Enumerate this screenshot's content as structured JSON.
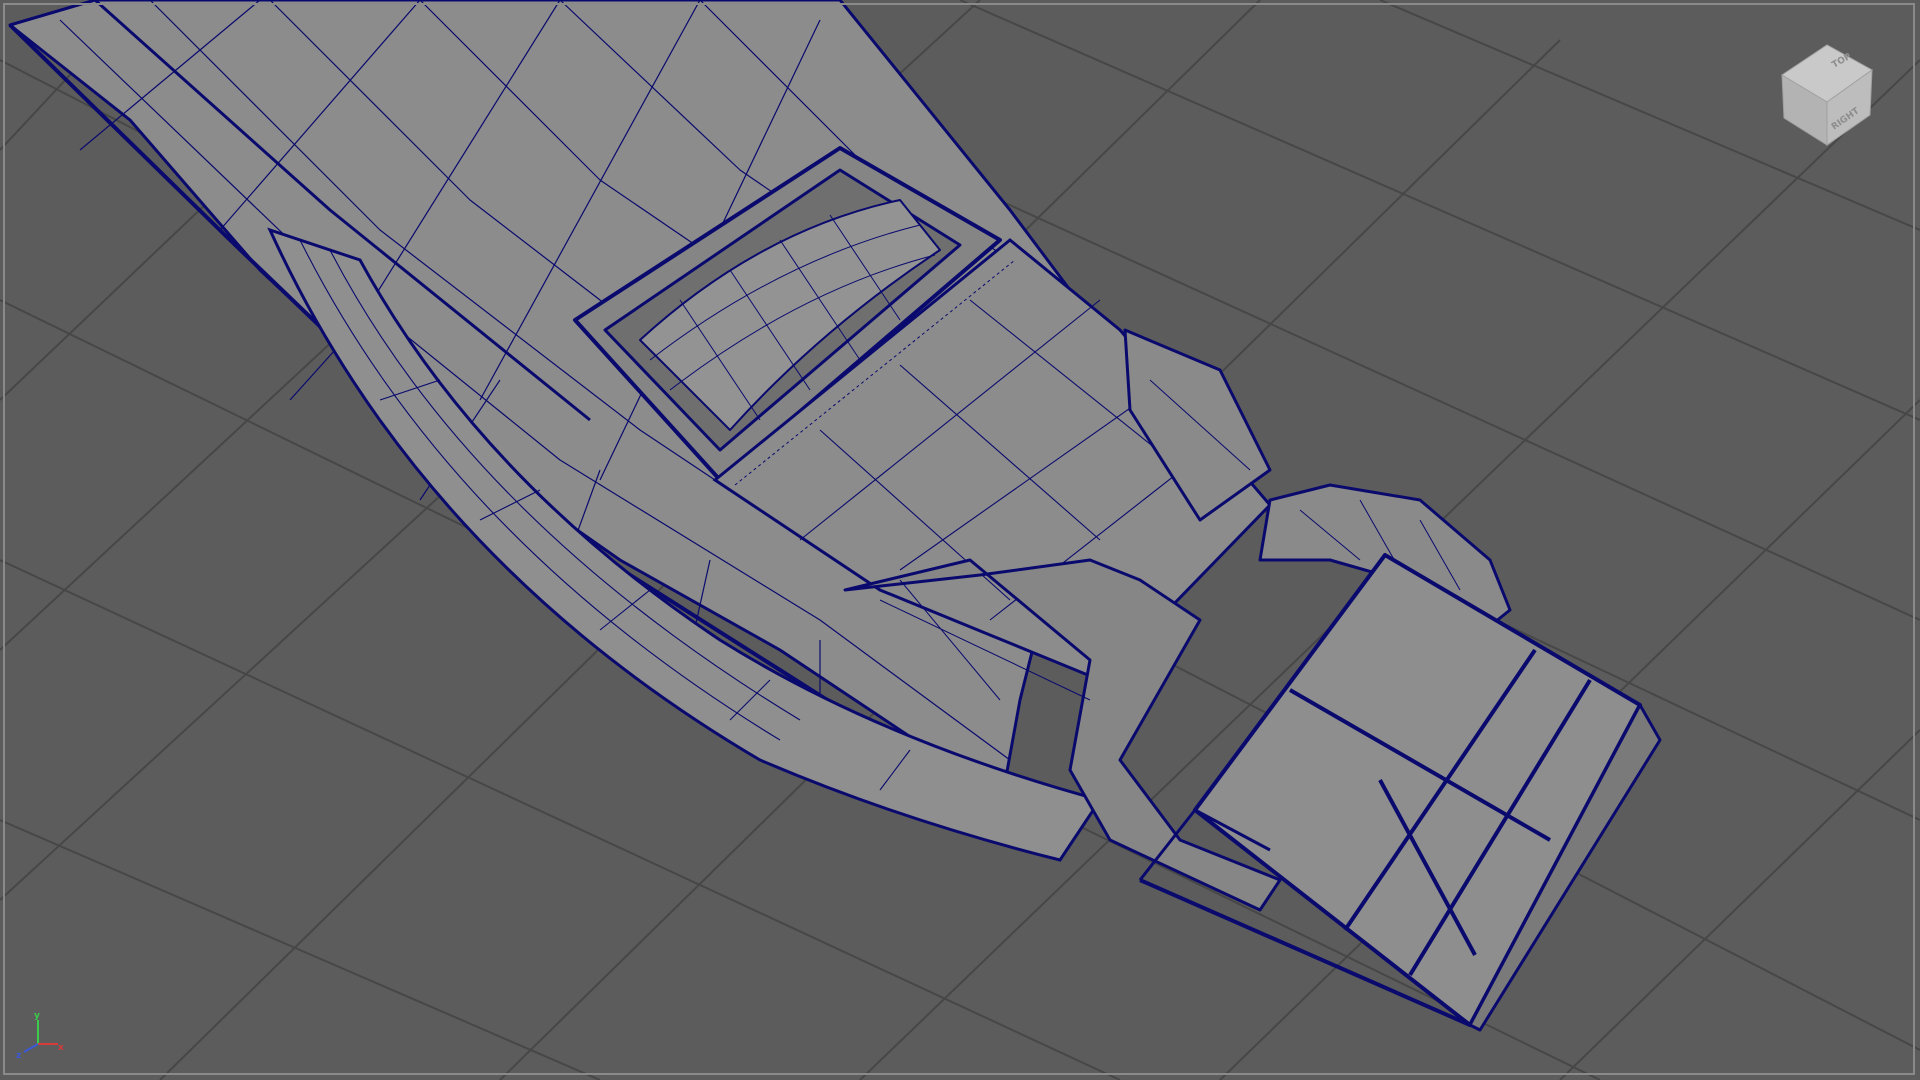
{
  "viewport": {
    "background_color": "#5c5c5c",
    "grid_color": "#444444",
    "wire_color": "#0a0a6e",
    "mesh_color": "#8c8c8c"
  },
  "view_cube": {
    "top_label": "TOP",
    "side_label": "RIGHT"
  },
  "axis_gizmo": {
    "x_label": "x",
    "y_label": "y",
    "z_label": "z",
    "x_color": "#d83a3a",
    "y_color": "#3acb4a",
    "z_color": "#3a5ad8"
  }
}
